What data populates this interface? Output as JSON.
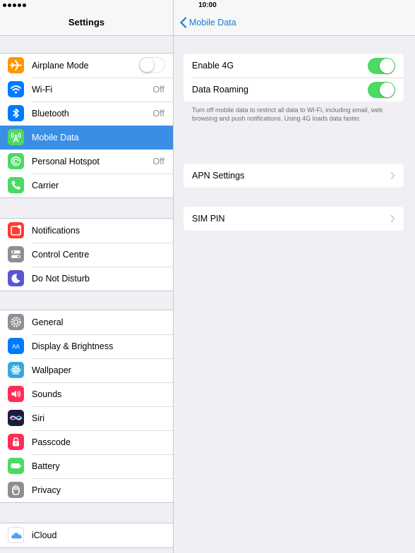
{
  "status_bar": {
    "time": "10:00"
  },
  "master": {
    "title": "Settings",
    "groups": [
      {
        "items": [
          {
            "label": "Airplane Mode",
            "icon": "airplane-icon",
            "color": "#ff9500",
            "control": "toggle-off"
          },
          {
            "label": "Wi-Fi",
            "icon": "wifi-icon",
            "color": "#007aff",
            "value": "Off"
          },
          {
            "label": "Bluetooth",
            "icon": "bluetooth-icon",
            "color": "#007aff",
            "value": "Off"
          },
          {
            "label": "Mobile Data",
            "icon": "antenna-icon",
            "color": "#4cd964",
            "selected": true
          },
          {
            "label": "Personal Hotspot",
            "icon": "hotspot-icon",
            "color": "#4cd964",
            "value": "Off"
          },
          {
            "label": "Carrier",
            "icon": "phone-icon",
            "color": "#4cd964"
          }
        ]
      },
      {
        "items": [
          {
            "label": "Notifications",
            "icon": "notifications-icon",
            "color": "#ff3b30"
          },
          {
            "label": "Control Centre",
            "icon": "control-centre-icon",
            "color": "#8e8e93"
          },
          {
            "label": "Do Not Disturb",
            "icon": "moon-icon",
            "color": "#5856d6"
          }
        ]
      },
      {
        "items": [
          {
            "label": "General",
            "icon": "gear-icon",
            "color": "#8e8e93"
          },
          {
            "label": "Display & Brightness",
            "icon": "display-icon",
            "color": "#007aff"
          },
          {
            "label": "Wallpaper",
            "icon": "wallpaper-icon",
            "color": "#34aadc"
          },
          {
            "label": "Sounds",
            "icon": "speaker-icon",
            "color": "#ff2d55"
          },
          {
            "label": "Siri",
            "icon": "siri-icon",
            "color": "#1c1c3a"
          },
          {
            "label": "Passcode",
            "icon": "lock-icon",
            "color": "#ff2d55"
          },
          {
            "label": "Battery",
            "icon": "battery-icon",
            "color": "#4cd964"
          },
          {
            "label": "Privacy",
            "icon": "hand-icon",
            "color": "#8e8e93"
          }
        ]
      },
      {
        "items": [
          {
            "label": "iCloud",
            "icon": "cloud-icon",
            "color": "#ffffff"
          }
        ]
      }
    ]
  },
  "detail": {
    "back_label": "Mobile Data",
    "enable_4g": {
      "label": "Enable 4G",
      "on": true
    },
    "data_roaming": {
      "label": "Data Roaming",
      "on": true
    },
    "footnote": "Turn off mobile data to restrict all data to Wi-Fi, including email, web browsing and push notifications. Using 4G loads data faster.",
    "apn_settings_label": "APN Settings",
    "sim_pin_label": "SIM PIN"
  }
}
